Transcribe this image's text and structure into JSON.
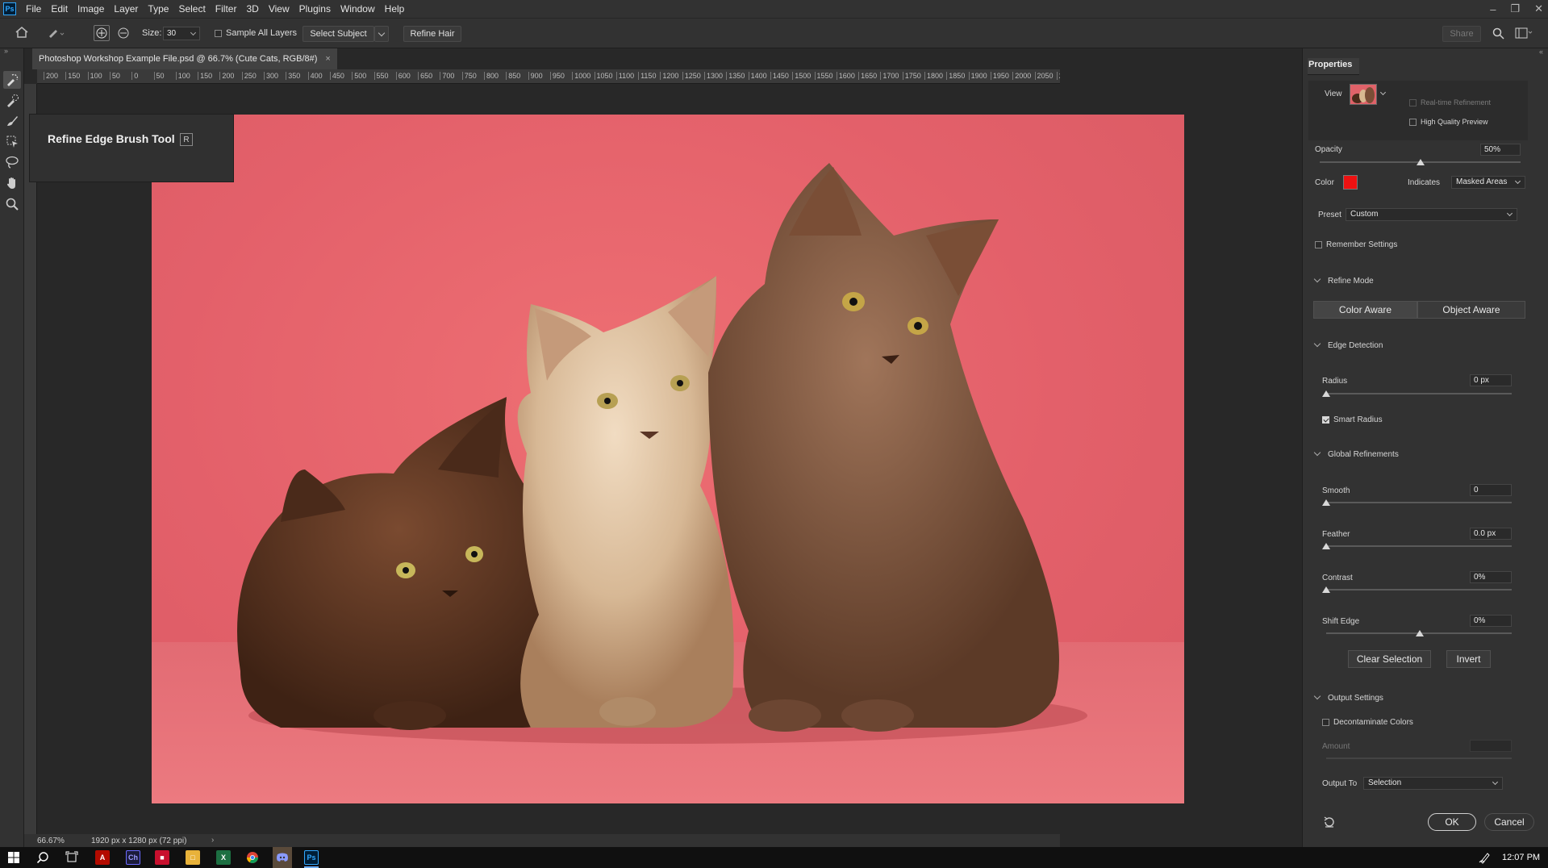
{
  "app": {
    "logo": "Ps"
  },
  "menu": [
    "File",
    "Edit",
    "Image",
    "Layer",
    "Type",
    "Select",
    "Filter",
    "3D",
    "View",
    "Plugins",
    "Window",
    "Help"
  ],
  "options_bar": {
    "size_label": "Size:",
    "size_value": "30",
    "sample_all_layers": "Sample All Layers",
    "select_subject": "Select Subject",
    "refine_hair": "Refine Hair",
    "share": "Share"
  },
  "document": {
    "tab_title": "Photoshop Workshop Example File.psd @ 66.7% (Cute Cats, RGB/8#)",
    "close": "×",
    "ruler_labels": [
      "200",
      "150",
      "100",
      "50",
      "0",
      "50",
      "100",
      "150",
      "200",
      "250",
      "300",
      "350",
      "400",
      "450",
      "500",
      "550",
      "600",
      "650",
      "700",
      "750",
      "800",
      "850",
      "900",
      "950",
      "1000",
      "1050",
      "1100",
      "1150",
      "1200",
      "1250",
      "1300",
      "1350",
      "1400",
      "1450",
      "1500",
      "1550",
      "1600",
      "1650",
      "1700",
      "1750",
      "1800",
      "1850",
      "1900",
      "1950",
      "2000",
      "2050",
      "21"
    ],
    "zoom": "66.67%",
    "dimensions": "1920 px x 1280 px (72 ppi)"
  },
  "tooltip": {
    "title": "Refine Edge Brush Tool",
    "shortcut": "R"
  },
  "properties": {
    "title": "Properties",
    "view_label": "View",
    "realtime_refinement": "Real-time Refinement",
    "high_quality_preview": "High Quality Preview",
    "opacity_label": "Opacity",
    "opacity_value": "50%",
    "opacity_level": 0.5,
    "color_label": "Color",
    "color_value": "#ee1111",
    "indicates_label": "Indicates",
    "indicates_value": "Masked Areas",
    "preset_label": "Preset",
    "preset_value": "Custom",
    "remember_settings": "Remember Settings",
    "refine_mode": {
      "title": "Refine Mode",
      "color_aware": "Color Aware",
      "object_aware": "Object Aware"
    },
    "edge_detection": {
      "title": "Edge Detection",
      "radius_label": "Radius",
      "radius_value": "0 px",
      "smart_radius": "Smart Radius"
    },
    "global_refinements": {
      "title": "Global Refinements",
      "smooth_label": "Smooth",
      "smooth_value": "0",
      "feather_label": "Feather",
      "feather_value": "0.0 px",
      "contrast_label": "Contrast",
      "contrast_value": "0%",
      "shift_edge_label": "Shift Edge",
      "shift_edge_value": "0%",
      "clear_selection": "Clear Selection",
      "invert": "Invert"
    },
    "output_settings": {
      "title": "Output Settings",
      "decontaminate": "Decontaminate Colors",
      "amount_label": "Amount",
      "output_to_label": "Output To",
      "output_to_value": "Selection"
    },
    "ok": "OK",
    "cancel": "Cancel"
  },
  "taskbar": {
    "time": "12:07 PM"
  }
}
